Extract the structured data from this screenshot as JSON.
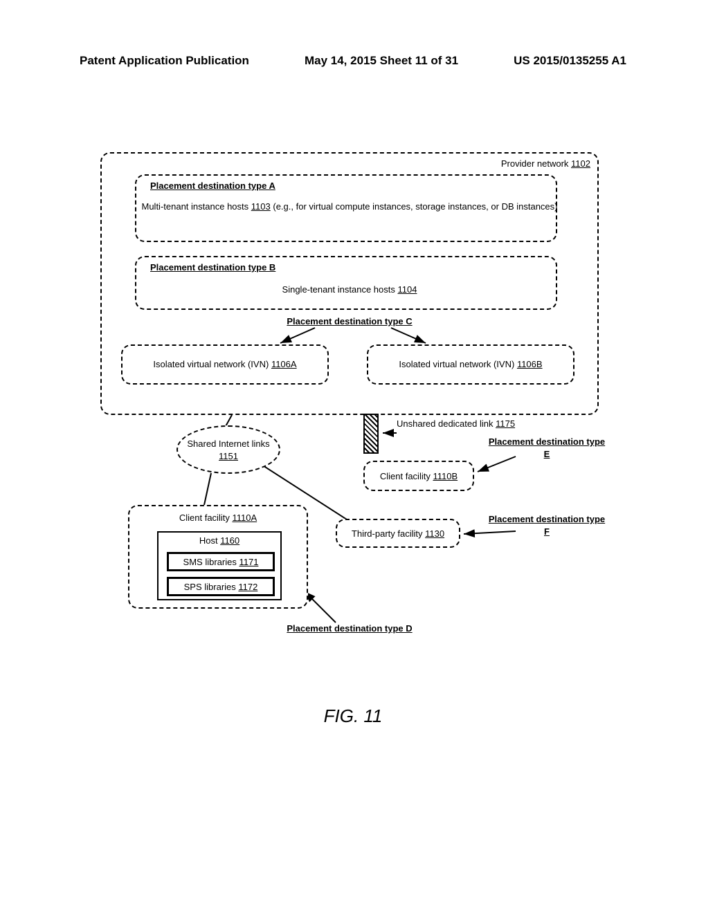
{
  "header": {
    "left": "Patent Application Publication",
    "center": "May 14, 2015   Sheet 11 of 31",
    "right": "US 2015/0135255 A1"
  },
  "provider": {
    "label": "Provider network",
    "ref": "1102"
  },
  "typeA": {
    "title": "Placement destination type A",
    "body_prefix": "Multi-tenant instance hosts",
    "body_ref": "1103",
    "body_suffix": " (e.g., for virtual compute instances, storage instances, or DB instances)"
  },
  "typeB": {
    "title": "Placement destination type B",
    "body_prefix": "Single-tenant instance hosts",
    "body_ref": "1104"
  },
  "typeC": {
    "title": "Placement destination type C",
    "ivn_a_label": "Isolated virtual network (IVN)",
    "ivn_a_ref": "1106A",
    "ivn_b_label": "Isolated virtual network (IVN)",
    "ivn_b_ref": "1106B"
  },
  "sharedLinks": {
    "label": "Shared Internet links",
    "ref": "1151"
  },
  "dedicatedLink": {
    "label": "Unshared dedicated link",
    "ref": "1175"
  },
  "typeE": {
    "title": "Placement destination type E"
  },
  "clientB": {
    "label": "Client facility",
    "ref": "1110B"
  },
  "thirdParty": {
    "label": "Third-party facility",
    "ref": "1130"
  },
  "typeF": {
    "title": "Placement destination type F"
  },
  "clientA": {
    "label": "Client facility",
    "ref": "1110A",
    "host_label": "Host",
    "host_ref": "1160",
    "sms_label": "SMS libraries",
    "sms_ref": "1171",
    "sps_label": "SPS libraries",
    "sps_ref": "1172"
  },
  "typeD": {
    "title": "Placement destination type D"
  },
  "figure": {
    "caption": "FIG. 11"
  }
}
